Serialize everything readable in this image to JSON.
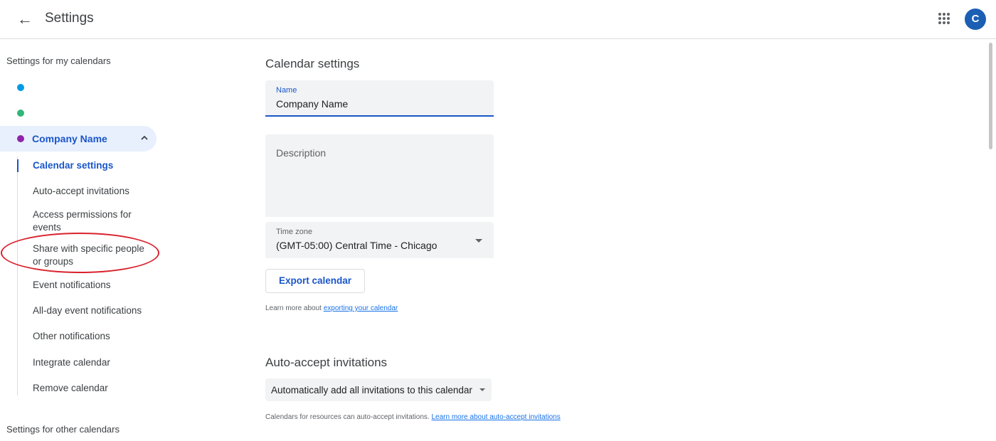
{
  "header": {
    "back_icon": "arrow-back-icon",
    "title": "Settings",
    "apps_icon": "apps-grid-icon",
    "avatar_initial": "C",
    "avatar_color": "#1a5fb4"
  },
  "sidebar": {
    "my_calendars_heading": "Settings for my calendars",
    "calendars": [
      {
        "name": "",
        "color": "#039be5"
      },
      {
        "name": "",
        "color": "#33b679"
      },
      {
        "name": "Company Name",
        "color": "#8e24aa"
      }
    ],
    "sub_items": [
      "Calendar settings",
      "Auto-accept invitations",
      "Access permissions for events",
      "Share with specific people or groups",
      "Event notifications",
      "All-day event notifications",
      "Other notifications",
      "Integrate calendar",
      "Remove calendar"
    ],
    "other_calendars_heading": "Settings for other calendars"
  },
  "main": {
    "calendar_settings_title": "Calendar settings",
    "name_label": "Name",
    "name_value": "Company Name",
    "description_placeholder": "Description",
    "timezone_label": "Time zone",
    "timezone_value": "(GMT-05:00) Central Time - Chicago",
    "export_button": "Export calendar",
    "export_help_prefix": "Learn more about",
    "export_help_link": "exporting your calendar",
    "auto_accept_title": "Auto-accept invitations",
    "auto_accept_value": "Automatically add all invitations to this calendar",
    "auto_accept_help_prefix": "Calendars for resources can auto-accept invitations.",
    "auto_accept_help_link": "Learn more about auto-accept invitations"
  },
  "accent_color": "#1a56c8",
  "annotation_color": "#d9232e"
}
